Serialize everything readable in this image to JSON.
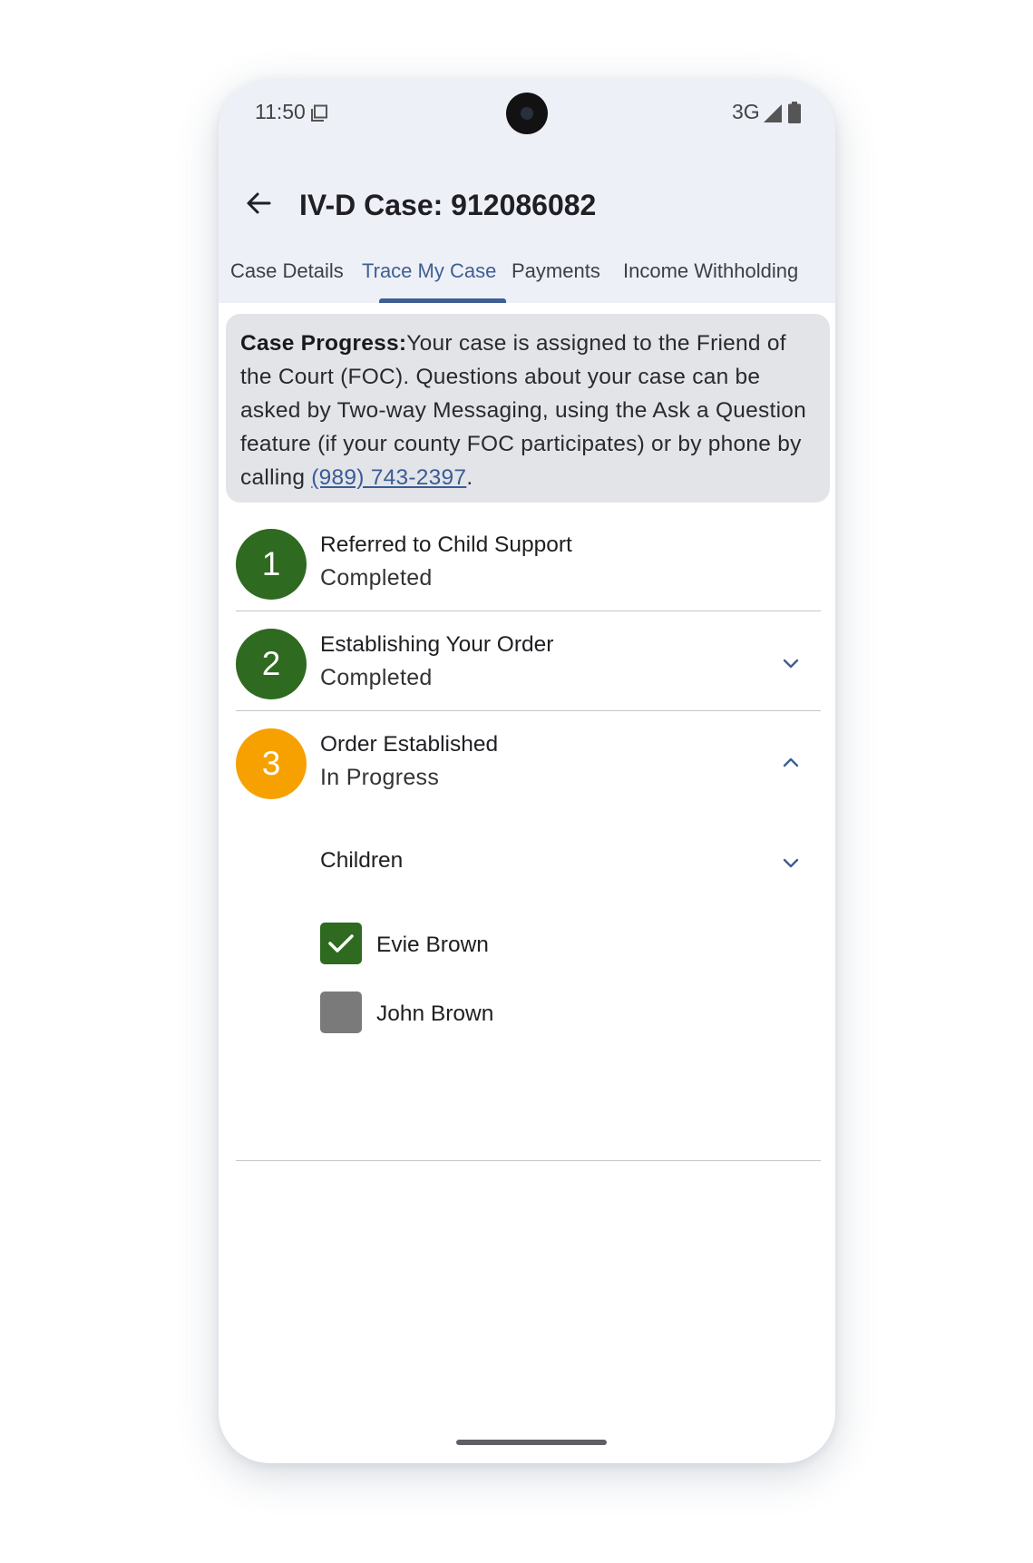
{
  "status_bar": {
    "time": "11:50",
    "network": "3G",
    "icons": [
      "screen-icon",
      "signal-icon",
      "battery-icon"
    ]
  },
  "app_bar": {
    "back_icon": "arrow-left-icon",
    "title": "IV-D Case: 912086082"
  },
  "tabs": [
    {
      "label": "Case Details",
      "active": false
    },
    {
      "label": "Trace My Case",
      "active": true
    },
    {
      "label": "Payments",
      "active": false
    },
    {
      "label": "Income Withholding",
      "active": false
    }
  ],
  "notice": {
    "heading": "Case Progress:",
    "body": "Your case is assigned to the Friend of the Court (FOC). Questions about your case can be asked by Two-way Messaging, using the Ask a Question feature (if your county FOC participates) or by phone by calling ",
    "phone": "(989) 743-2397",
    "suffix": "."
  },
  "steps": [
    {
      "number": "1",
      "title": "Referred to Child Support",
      "status": "Completed",
      "color": "#2e6a1f",
      "chevron": "none"
    },
    {
      "number": "2",
      "title": "Establishing Your Order",
      "status": "Completed",
      "color": "#2e6a1f",
      "chevron": "chevron-down-icon"
    },
    {
      "number": "3",
      "title": "Order Established",
      "status": "In Progress",
      "color": "#f6a100",
      "chevron": "chevron-up-icon"
    }
  ],
  "children": {
    "label": "Children",
    "chevron": "chevron-down-icon",
    "items": [
      {
        "name": "Evie Brown",
        "checked": true,
        "color": "#2e6a1f"
      },
      {
        "name": "John Brown",
        "checked": false,
        "color": "#7a7a7a"
      }
    ]
  },
  "colors": {
    "accent": "#3e5f93",
    "complete": "#2e6a1f",
    "in_progress": "#f6a100",
    "header_bg": "#eef0f8",
    "notice_bg": "#e3e4e8"
  }
}
